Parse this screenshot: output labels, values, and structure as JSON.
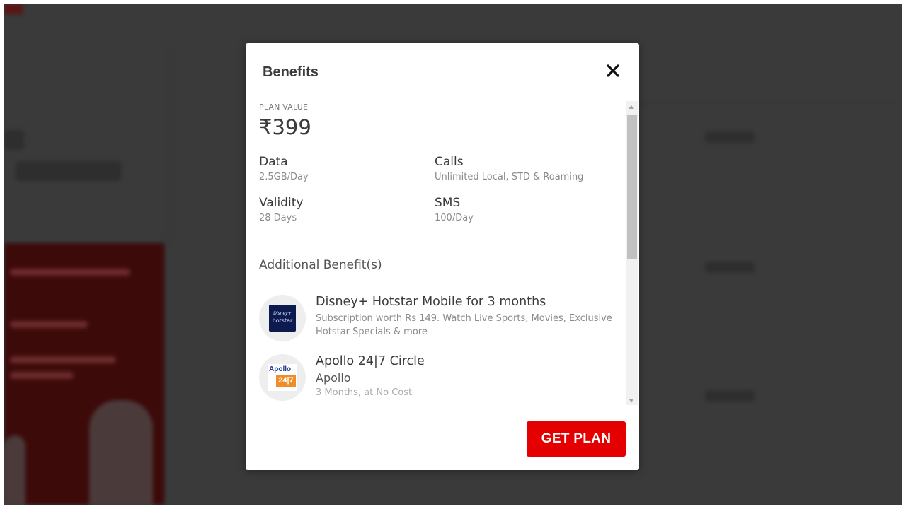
{
  "modal": {
    "title": "Benefits",
    "close_icon": "close-icon"
  },
  "plan": {
    "value_label": "PLAN VALUE",
    "price": "₹399"
  },
  "specs": [
    {
      "title": "Data",
      "value": "2.5GB/Day"
    },
    {
      "title": "Calls",
      "value": "Unlimited Local, STD & Roaming"
    },
    {
      "title": "Validity",
      "value": "28 Days"
    },
    {
      "title": "SMS",
      "value": "100/Day"
    }
  ],
  "additional": {
    "heading": "Additional Benefit(s)",
    "items": [
      {
        "title": "Disney+ Hotstar Mobile for 3 months",
        "description": "Subscription worth Rs 149. Watch Live Sports, Movies, Exclusive Hotstar Specials & more",
        "logo_text_top": "Disney+",
        "logo_text_bottom": "hotstar",
        "icon": "hotstar-logo"
      },
      {
        "title": "Apollo 24|7 Circle",
        "subtitle": "Apollo",
        "note": "3 Months, at No Cost",
        "logo_text_top": "Apollo",
        "logo_text_bottom": "24|7",
        "icon": "apollo-logo"
      }
    ]
  },
  "cta": {
    "label": "GET PLAN",
    "color": "#e40000"
  }
}
